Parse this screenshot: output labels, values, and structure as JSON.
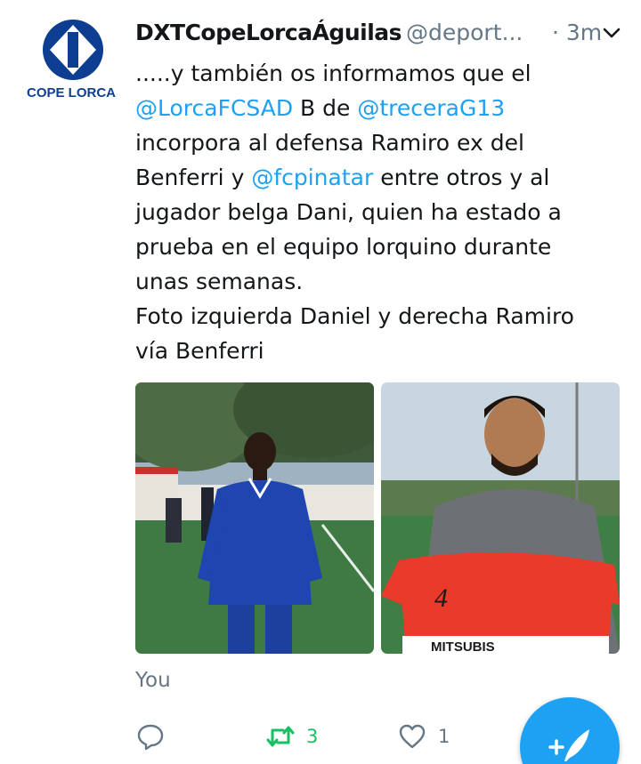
{
  "tweet": {
    "author": {
      "display_name": "DXTCopeLorcaÁguilas",
      "handle": "@deport...",
      "avatar_icon": "cope-lorca-logo",
      "logo_text": "COPE LORCA"
    },
    "time": "· 3m",
    "menu_icon": "chevron-down-icon",
    "text_lines": [
      [
        {
          "t": ".....y también os informamos que el"
        }
      ],
      [
        {
          "t": "@LorcaFCSAD",
          "mention": true
        },
        {
          "t": " B de "
        },
        {
          "t": "@treceraG13",
          "mention": true
        }
      ],
      [
        {
          "t": "incorpora al defensa Ramiro ex del"
        }
      ],
      [
        {
          "t": "Benferri y "
        },
        {
          "t": "@fcpinatar",
          "mention": true
        },
        {
          "t": " entre otros y al"
        }
      ],
      [
        {
          "t": "jugador belga Dani, quien ha estado a"
        }
      ],
      [
        {
          "t": "prueba en el equipo lorquino durante"
        }
      ],
      [
        {
          "t": "unas semanas."
        }
      ],
      [
        {
          "t": "Foto izquierda Daniel y derecha Ramiro"
        }
      ],
      [
        {
          "t": "vía Benferri"
        }
      ]
    ],
    "media": [
      {
        "name": "photo-daniel",
        "description": "player in blue tracksuit on football pitch"
      },
      {
        "name": "photo-ramiro",
        "description": "player holding red jersey number 4",
        "jersey_number": "4",
        "jersey_sponsor": "MITSUBIS"
      }
    ],
    "attribution": "You",
    "actions": {
      "reply": {
        "icon": "reply-icon",
        "count": ""
      },
      "retweet": {
        "icon": "retweet-icon",
        "count": "3"
      },
      "like": {
        "icon": "heart-icon",
        "count": "1"
      }
    },
    "compose_icon": "compose-tweet-icon"
  },
  "colors": {
    "link": "#1da1f2",
    "muted": "#657786",
    "retweet_active": "#17bf63",
    "fab": "#1da1f2"
  }
}
